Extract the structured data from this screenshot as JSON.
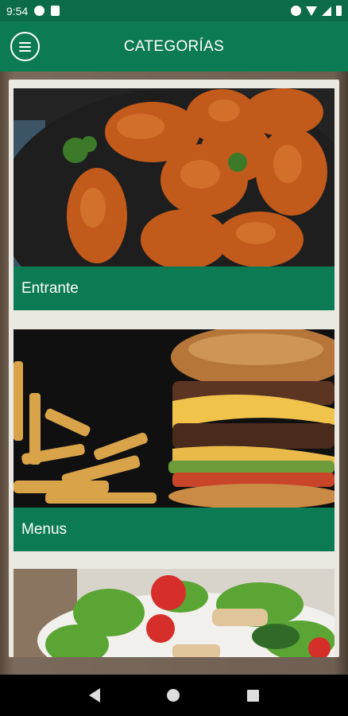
{
  "status_bar": {
    "time": "9:54",
    "icons": [
      "record-icon",
      "sd-card-icon",
      "vibrate-icon",
      "wifi-icon",
      "signal-icon",
      "battery-icon"
    ]
  },
  "app_bar": {
    "menu_icon": "hamburger-menu-icon",
    "title": "CATEGORÍAS"
  },
  "categories": [
    {
      "label": "Entrante",
      "image": "fried-chicken-wings-photo"
    },
    {
      "label": "Menus",
      "image": "burger-and-fries-photo"
    },
    {
      "label": "",
      "image": "salad-photo"
    }
  ],
  "nav_bar": {
    "back_icon": "back-triangle-icon",
    "home_icon": "home-circle-icon",
    "recent_icon": "recent-apps-square-icon"
  },
  "colors": {
    "primary": "#0c7a52",
    "status_bar": "#0c6b48",
    "panel": "#ebe8e2"
  }
}
